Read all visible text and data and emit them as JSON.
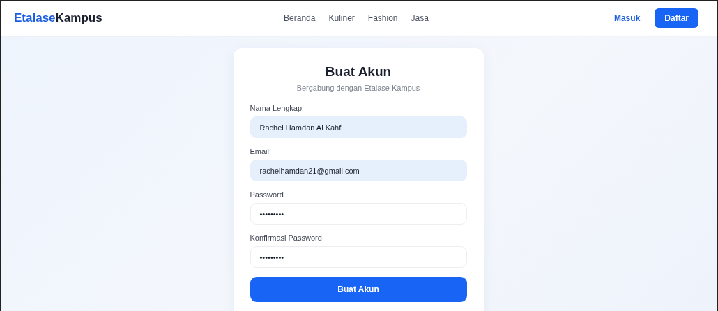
{
  "navbar": {
    "logo": {
      "part_1": "Etalase",
      "part_2": "Kampus"
    },
    "links": [
      "Beranda",
      "Kuliner",
      "Fashion",
      "Jasa"
    ],
    "login": "Masuk",
    "register": "Daftar"
  },
  "form": {
    "title": "Buat Akun",
    "subtitle": "Bergabung dengan Etalase Kampus",
    "fields": [
      {
        "label": "Nama Lengkap",
        "value": "Rachel Hamdan Al Kahfi",
        "autofilled": true
      },
      {
        "label": "Email",
        "value": "rachelhamdan21@gmail.com",
        "autofilled": true
      },
      {
        "label": "Password",
        "value": "•••••••••",
        "autofilled": false
      },
      {
        "label": "Konfirmasi Password",
        "value": "•••••••••",
        "autofilled": false
      }
    ],
    "submit": "Buat Akun"
  }
}
